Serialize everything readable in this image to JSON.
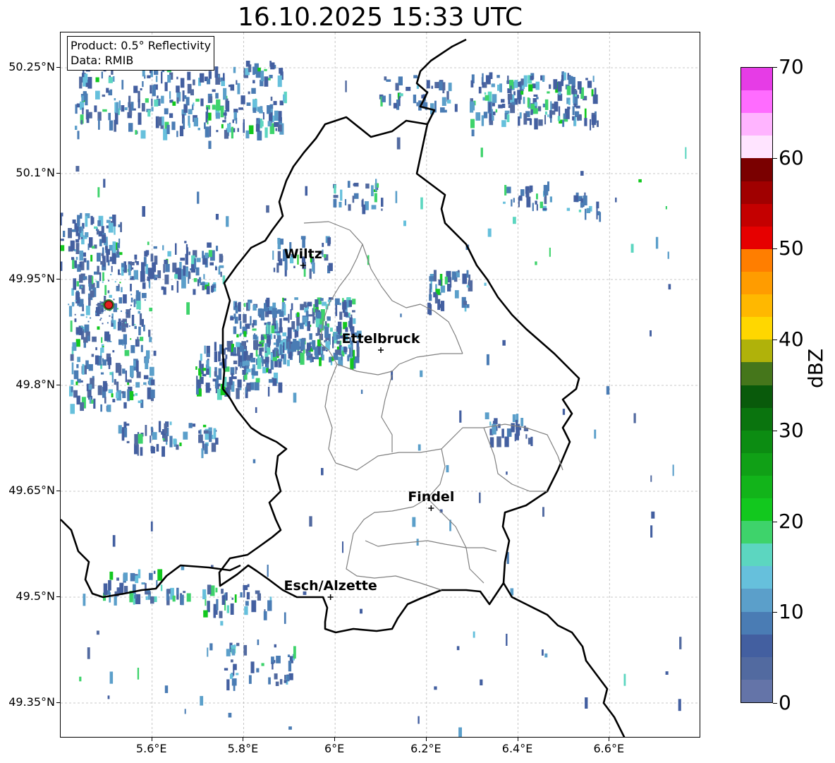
{
  "title": "16.10.2025 15:33 UTC",
  "info_box": {
    "line1": "Product: 0.5° Reflectivity",
    "line2": "Data: RMIB"
  },
  "map": {
    "lon_range": [
      5.4,
      6.8
    ],
    "lat_range": [
      49.3,
      50.3
    ],
    "lat_ticks": [
      {
        "value": 50.25,
        "label": "50.25°N"
      },
      {
        "value": 50.1,
        "label": "50.1°N"
      },
      {
        "value": 49.95,
        "label": "49.95°N"
      },
      {
        "value": 49.8,
        "label": "49.8°N"
      },
      {
        "value": 49.65,
        "label": "49.65°N"
      },
      {
        "value": 49.5,
        "label": "49.5°N"
      },
      {
        "value": 49.35,
        "label": "49.35°N"
      }
    ],
    "lon_ticks": [
      {
        "value": 5.6,
        "label": "5.6°E"
      },
      {
        "value": 5.8,
        "label": "5.8°E"
      },
      {
        "value": 6.0,
        "label": "6°E"
      },
      {
        "value": 6.2,
        "label": "6.2°E"
      },
      {
        "value": 6.4,
        "label": "6.4°E"
      },
      {
        "value": 6.6,
        "label": "6.6°E"
      }
    ],
    "cities": [
      {
        "name": "Wiltz",
        "lon": 5.93,
        "lat": 49.97
      },
      {
        "name": "Ettelbruck",
        "lon": 6.1,
        "lat": 49.85
      },
      {
        "name": "Findel",
        "lon": 6.21,
        "lat": 49.626
      },
      {
        "name": "Esch/Alzette",
        "lon": 5.99,
        "lat": 49.5
      }
    ],
    "radar_site": {
      "lon": 5.505,
      "lat": 49.914
    }
  },
  "colorbar": {
    "title": "dBZ",
    "min": 0,
    "max": 70,
    "ticks": [
      "0",
      "10",
      "20",
      "30",
      "40",
      "50",
      "60",
      "70"
    ],
    "colors": [
      "#6474a8",
      "#526aa0",
      "#435fa0",
      "#4a7cb4",
      "#5b9fca",
      "#66c0dc",
      "#5cd6c0",
      "#3ed36b",
      "#12c81e",
      "#12b41a",
      "#10a016",
      "#0c8c12",
      "#0a740e",
      "#095a0b",
      "#45761b",
      "#b0b20a",
      "#ffd700",
      "#ffb800",
      "#ff9c00",
      "#ff7e00",
      "#e60000",
      "#c40000",
      "#a00000",
      "#7a0000",
      "#ffe4ff",
      "#ffb4ff",
      "#ff6cff",
      "#e63ce6"
    ]
  }
}
